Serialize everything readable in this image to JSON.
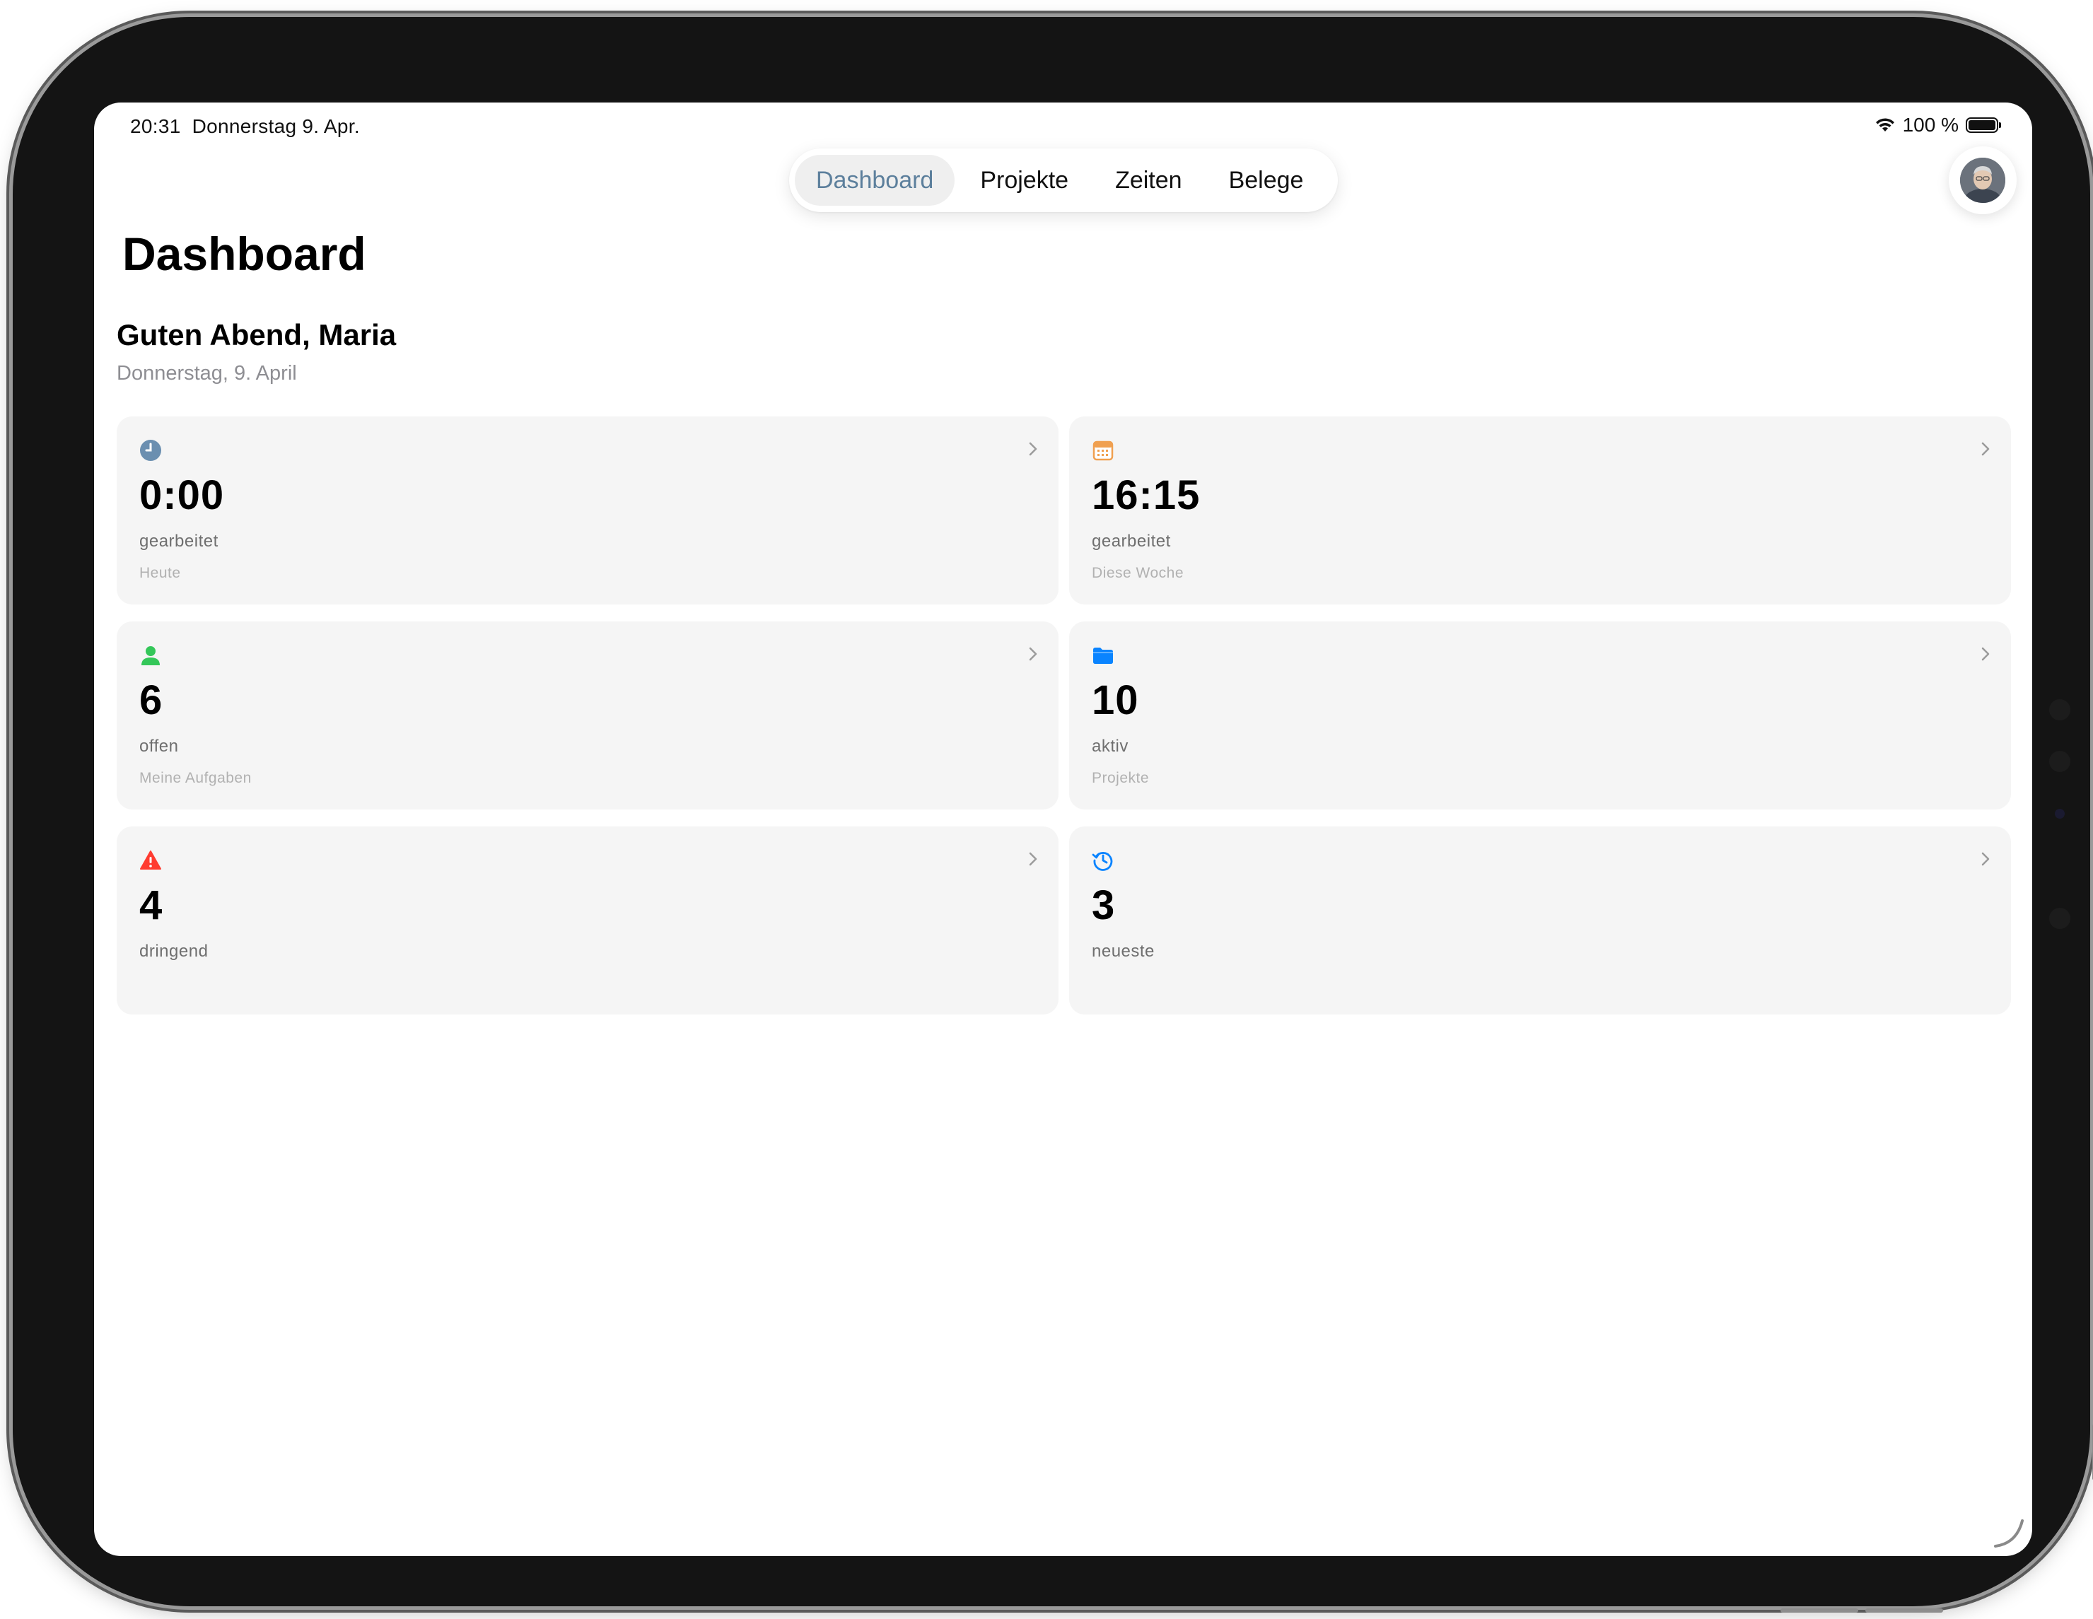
{
  "status_bar": {
    "time": "20:31",
    "date": "Donnerstag 9. Apr.",
    "battery_text": "100 %",
    "wifi_icon": "wifi-icon",
    "battery_icon": "battery-icon"
  },
  "tabs": [
    {
      "label": "Dashboard",
      "active": true
    },
    {
      "label": "Projekte",
      "active": false
    },
    {
      "label": "Zeiten",
      "active": false
    },
    {
      "label": "Belege",
      "active": false
    }
  ],
  "page": {
    "title": "Dashboard",
    "greeting": "Guten Abend, Maria",
    "date": "Donnerstag, 9. April"
  },
  "cards": [
    {
      "icon": "clock-icon",
      "icon_color": "#6b8fb0",
      "value": "0:00",
      "label": "gearbeitet",
      "sub": "Heute"
    },
    {
      "icon": "calendar-icon",
      "icon_color": "#f0a050",
      "value": "16:15",
      "label": "gearbeitet",
      "sub": "Diese Woche"
    },
    {
      "icon": "person-icon",
      "icon_color": "#34c759",
      "value": "6",
      "label": "offen",
      "sub": "Meine Aufgaben"
    },
    {
      "icon": "folder-icon",
      "icon_color": "#0a84ff",
      "value": "10",
      "label": "aktiv",
      "sub": "Projekte"
    },
    {
      "icon": "warning-icon",
      "icon_color": "#ff3b30",
      "value": "4",
      "label": "dringend",
      "sub": ""
    },
    {
      "icon": "history-icon",
      "icon_color": "#0a84ff",
      "value": "3",
      "label": "neueste",
      "sub": ""
    }
  ]
}
